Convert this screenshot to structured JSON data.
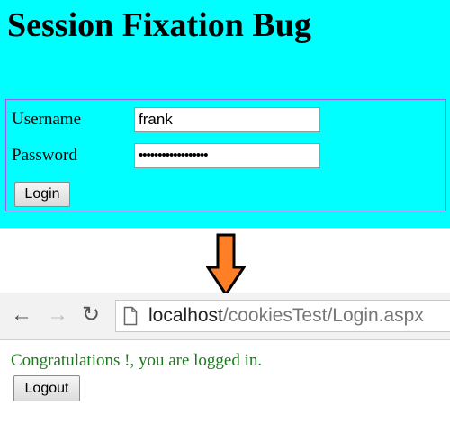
{
  "login_page": {
    "title": "Session Fixation Bug",
    "username_label": "Username",
    "username_value": "frank",
    "password_label": "Password",
    "password_value": "••••••••••••••••••",
    "login_button": "Login"
  },
  "arrow": {
    "icon": "down-arrow-icon",
    "color": "#ff7f27"
  },
  "browser": {
    "url_host": "localhost",
    "url_path": "/cookiesTest/Login.aspx"
  },
  "result_page": {
    "message": "Congratulations !, you are logged in.",
    "message_color": "#1a7a1a",
    "logout_button": "Logout"
  },
  "colors": {
    "panel_background": "#00ffff",
    "box_border": "#9a5cff"
  }
}
